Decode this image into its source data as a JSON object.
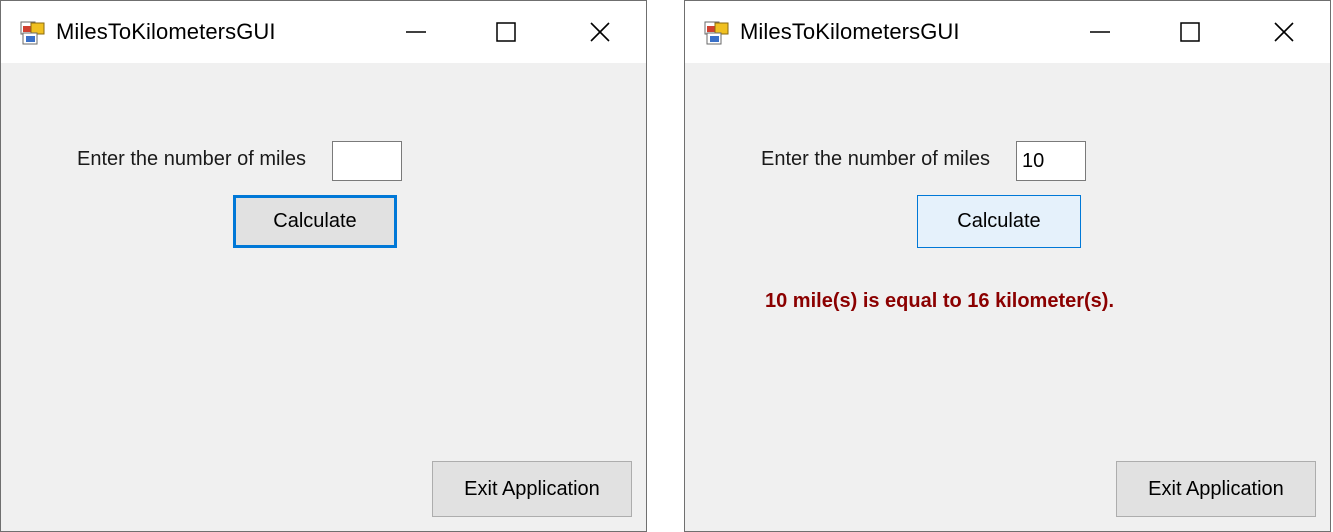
{
  "windows": [
    {
      "title": "MilesToKilometersGUI",
      "prompt_label": "Enter the number of miles",
      "miles_input_value": "",
      "calculate_label": "Calculate",
      "result_text": "",
      "exit_label": "Exit Application"
    },
    {
      "title": "MilesToKilometersGUI",
      "prompt_label": "Enter the number of miles",
      "miles_input_value": "10",
      "calculate_label": "Calculate",
      "result_text": "10 mile(s) is equal to  16 kilometer(s).",
      "exit_label": "Exit Application"
    }
  ],
  "colors": {
    "result_text": "#8b0000",
    "focus_accent": "#0078d7",
    "client_background": "#f0f0f0"
  },
  "icons": {
    "app": "app-window-icon",
    "minimize": "minimize-icon",
    "maximize": "maximize-icon",
    "close": "close-icon"
  }
}
